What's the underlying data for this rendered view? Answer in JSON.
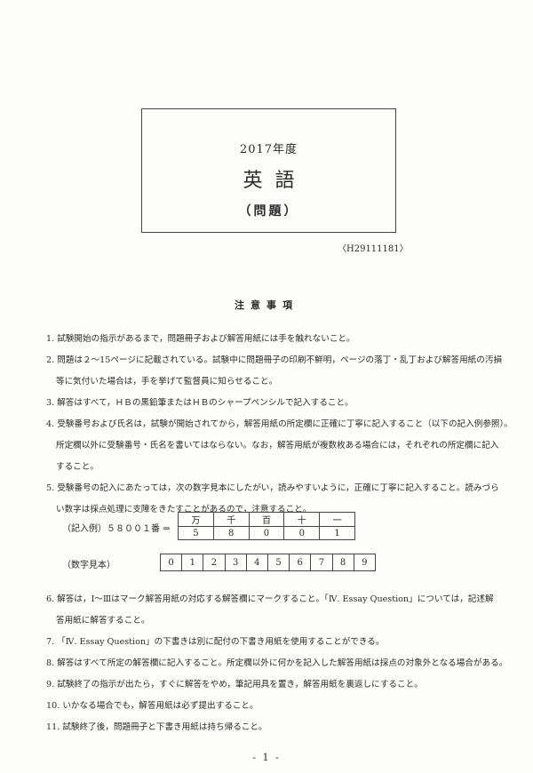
{
  "title_box": {
    "year": "2017年度",
    "subject": "英語",
    "kind": "（問題）"
  },
  "exam_code": "〈H29111181〉",
  "notes_heading": "注意事項",
  "notes": [
    {
      "num": "1.",
      "lines": [
        "試験開始の指示があるまで，問題冊子および解答用紙には手を触れないこと。"
      ]
    },
    {
      "num": "2.",
      "lines": [
        "問題は２～15ページに記載されている。試験中に問題冊子の印刷不鮮明，ページの落丁・乱丁および解答用紙の汚損",
        "等に気付いた場合は，手を挙げて監督員に知らせること。"
      ]
    },
    {
      "num": "3.",
      "lines": [
        "解答はすべて，ＨＢの黒鉛筆またはＨＢのシャープペンシルで記入すること。"
      ]
    },
    {
      "num": "4.",
      "lines": [
        "受験番号および氏名は，試験が開始されてから，解答用紙の所定欄に正確に丁寧に記入すること（以下の記入例参照）。",
        "所定欄以外に受験番号・氏名を書いてはならない。なお，解答用紙が複数枚ある場合には，それぞれの所定欄に記入",
        "すること。"
      ]
    },
    {
      "num": "5.",
      "lines": [
        "受験番号の記入にあたっては，次の数字見本にしたがい，読みやすいように，正確に丁寧に記入すること。読みづら",
        "い数字は採点処理に支障をきたすことがあるので，注意すること。"
      ]
    },
    {
      "num": "6.",
      "lines": [
        "解答は，Ⅰ～Ⅲはマーク解答用紙の対応する解答欄にマークすること。「Ⅳ. Essay Question」については，記述解",
        "答用紙に解答すること。"
      ]
    },
    {
      "num": "7.",
      "lines": [
        "「Ⅳ. Essay Question」の下書きは別に配付の下書き用紙を使用することができる。"
      ]
    },
    {
      "num": "8.",
      "lines": [
        "解答はすべて所定の解答欄に記入すること。所定欄以外に何かを記入した解答用紙は採点の対象外となる場合がある。"
      ]
    },
    {
      "num": "9.",
      "lines": [
        "試験終了の指示が出たら，すぐに解答をやめ，筆記用具を置き，解答用紙を裏返しにすること。"
      ]
    },
    {
      "num": "10.",
      "lines": [
        "いかなる場合でも，解答用紙は必ず提出すること。"
      ]
    },
    {
      "num": "11.",
      "lines": [
        "試験終了後，問題冊子と下書き用紙は持ち帰ること。"
      ]
    }
  ],
  "example": {
    "label": "（記入例）５８００１番 ⇒",
    "headers": [
      "万",
      "千",
      "百",
      "十",
      "一"
    ],
    "digits": [
      "5",
      "8",
      "0",
      "0",
      "1"
    ]
  },
  "sample": {
    "label": "（数字見本）",
    "digits": [
      "0",
      "1",
      "2",
      "3",
      "4",
      "5",
      "6",
      "7",
      "8",
      "9"
    ]
  },
  "page_number": "- 1 -"
}
